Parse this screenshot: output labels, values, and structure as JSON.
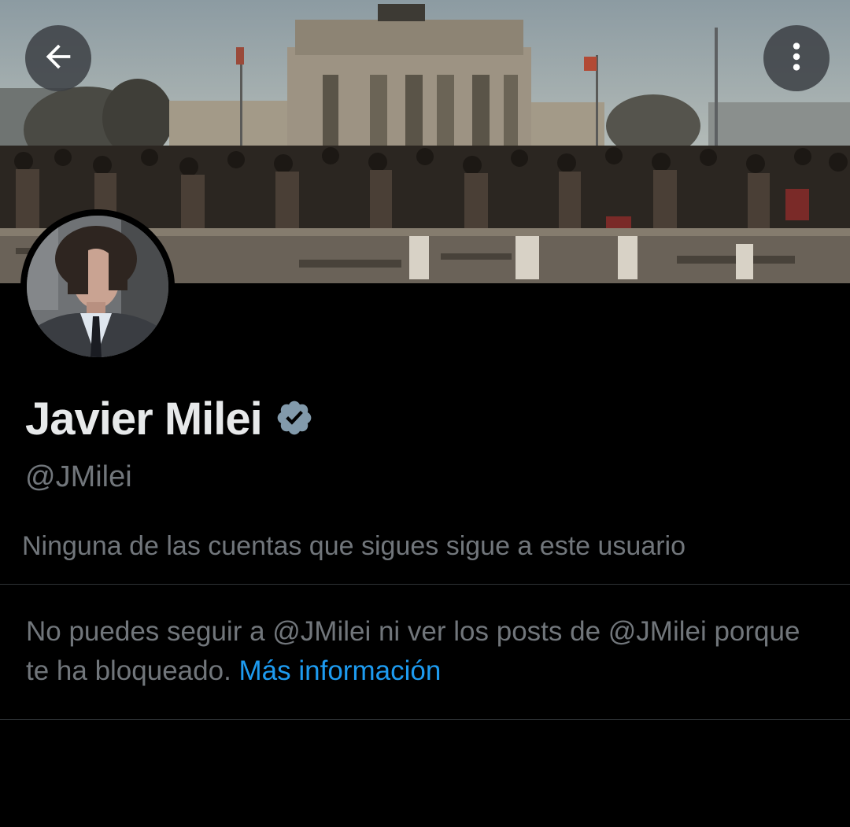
{
  "header": {
    "back_icon": "arrow-left-icon",
    "more_icon": "more-vertical-icon"
  },
  "profile": {
    "display_name": "Javier Milei",
    "verified_icon": "verified-badge-icon",
    "handle": "@JMilei",
    "followers_you_know": "Ninguna de las cuentas que sigues sigue a este usuario"
  },
  "blocked": {
    "message": "No puedes seguir a @JMilei ni ver los posts de @JMilei porque te ha bloqueado.",
    "link_label": "Más información"
  },
  "colors": {
    "background": "#000000",
    "text_primary": "#e7e9ea",
    "text_secondary": "#71767b",
    "link": "#1d9bf0",
    "divider": "#2f3336",
    "verified_badge": "#829aab"
  }
}
